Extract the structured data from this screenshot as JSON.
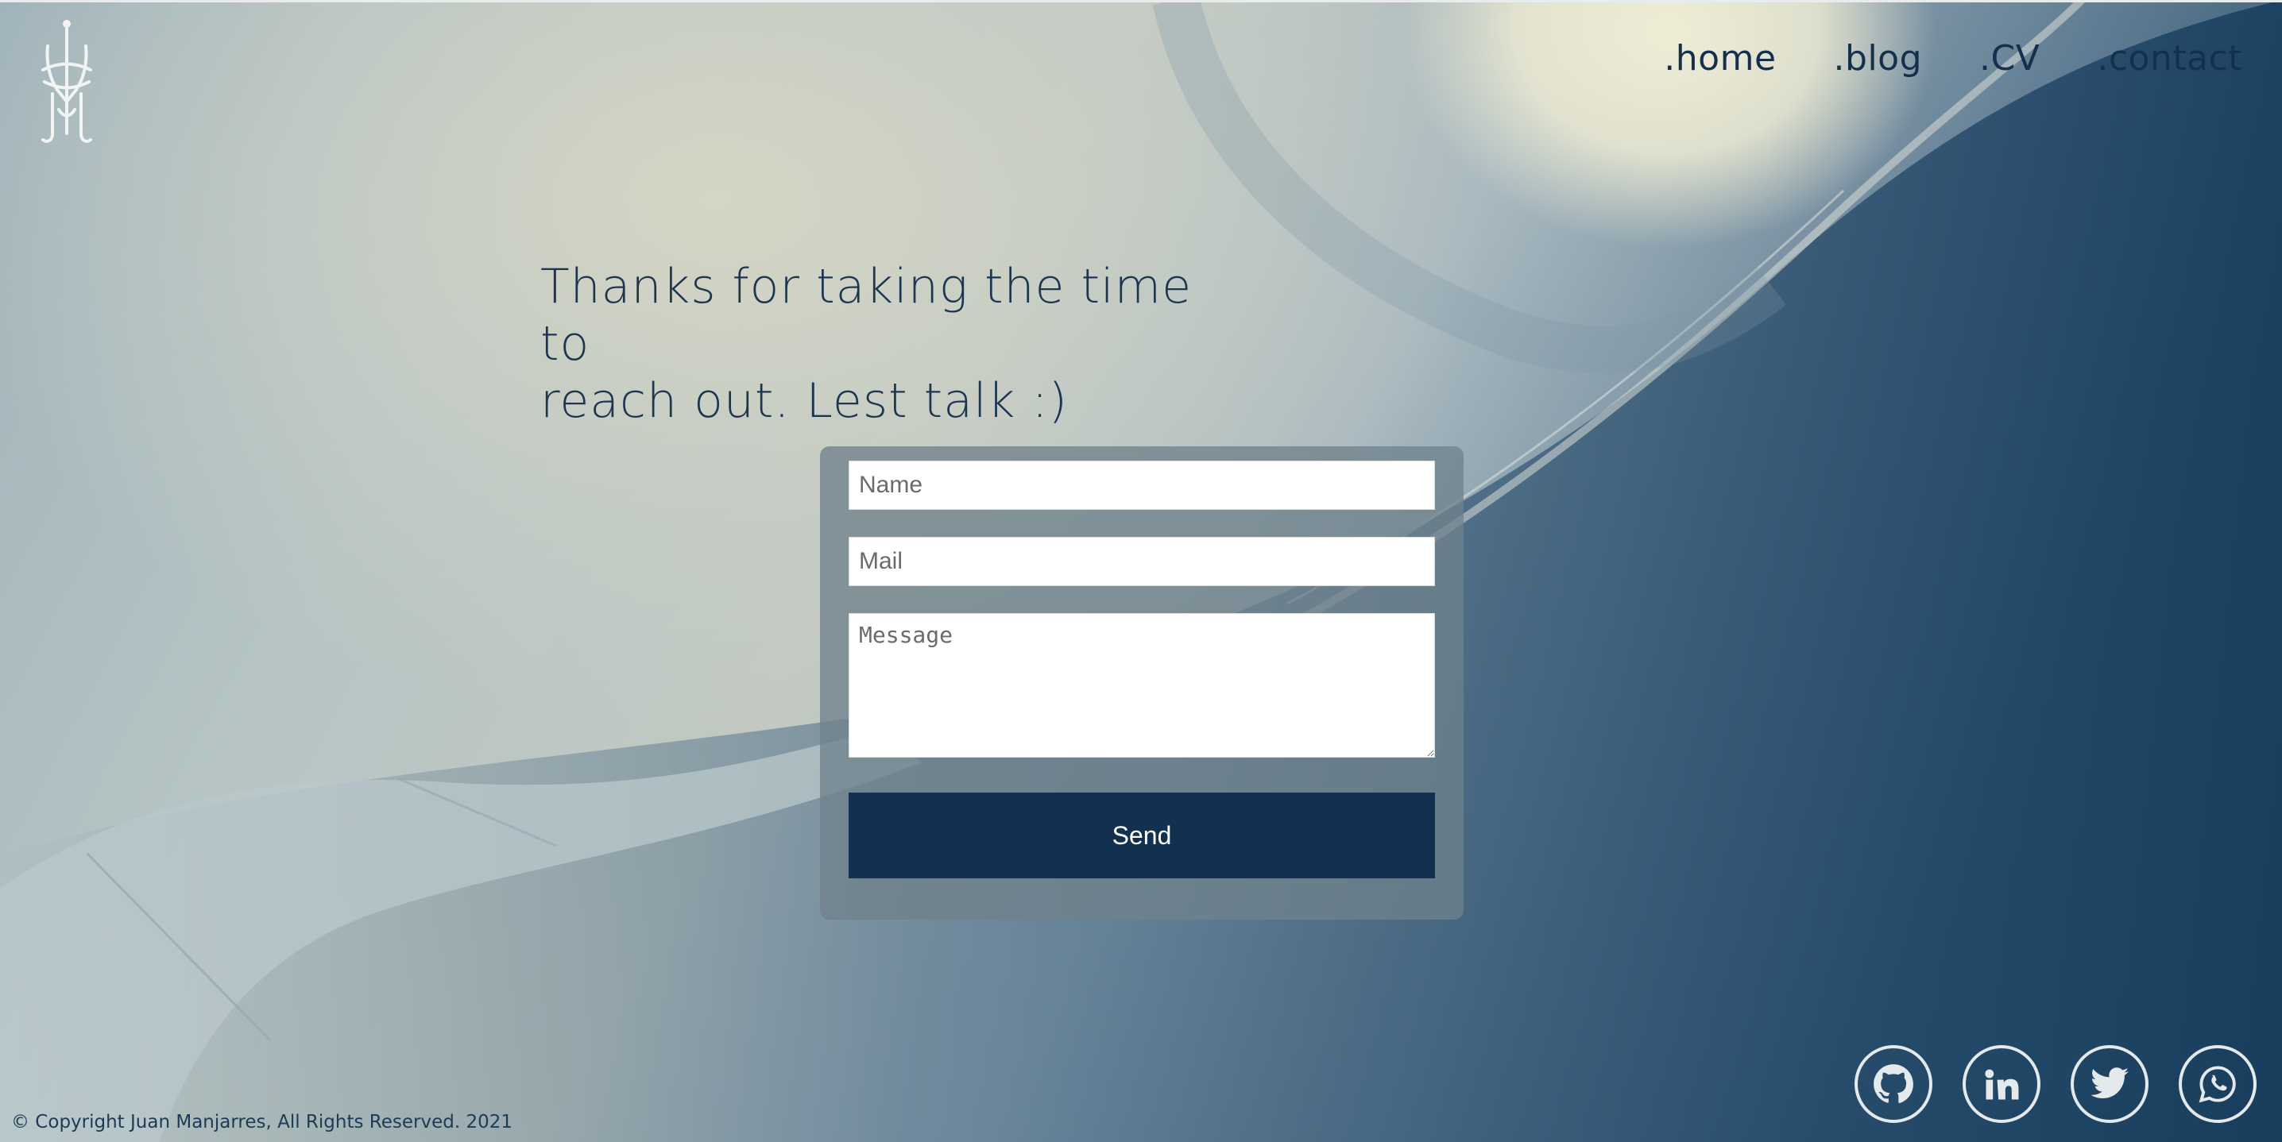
{
  "nav": {
    "items": [
      {
        "label": ".home"
      },
      {
        "label": ".blog"
      },
      {
        "label": ".CV"
      },
      {
        "label": ".contact"
      }
    ]
  },
  "headline": {
    "line1": "Thanks for taking the time to",
    "line2": "reach out. Lest talk :)"
  },
  "form": {
    "name_placeholder": "Name",
    "mail_placeholder": "Mail",
    "message_placeholder": "Message",
    "send_label": "Send"
  },
  "socials": [
    {
      "icon": "github-icon"
    },
    {
      "icon": "linkedin-icon"
    },
    {
      "icon": "twitter-icon"
    },
    {
      "icon": "whatsapp-icon"
    }
  ],
  "footer": {
    "copyright": "© Copyright Juan Manjarres, All Rights Reserved. 2021"
  },
  "colors": {
    "brand_navy": "#12304f",
    "nav_text": "#14304d",
    "icon_ring": "#e4e9ec"
  }
}
